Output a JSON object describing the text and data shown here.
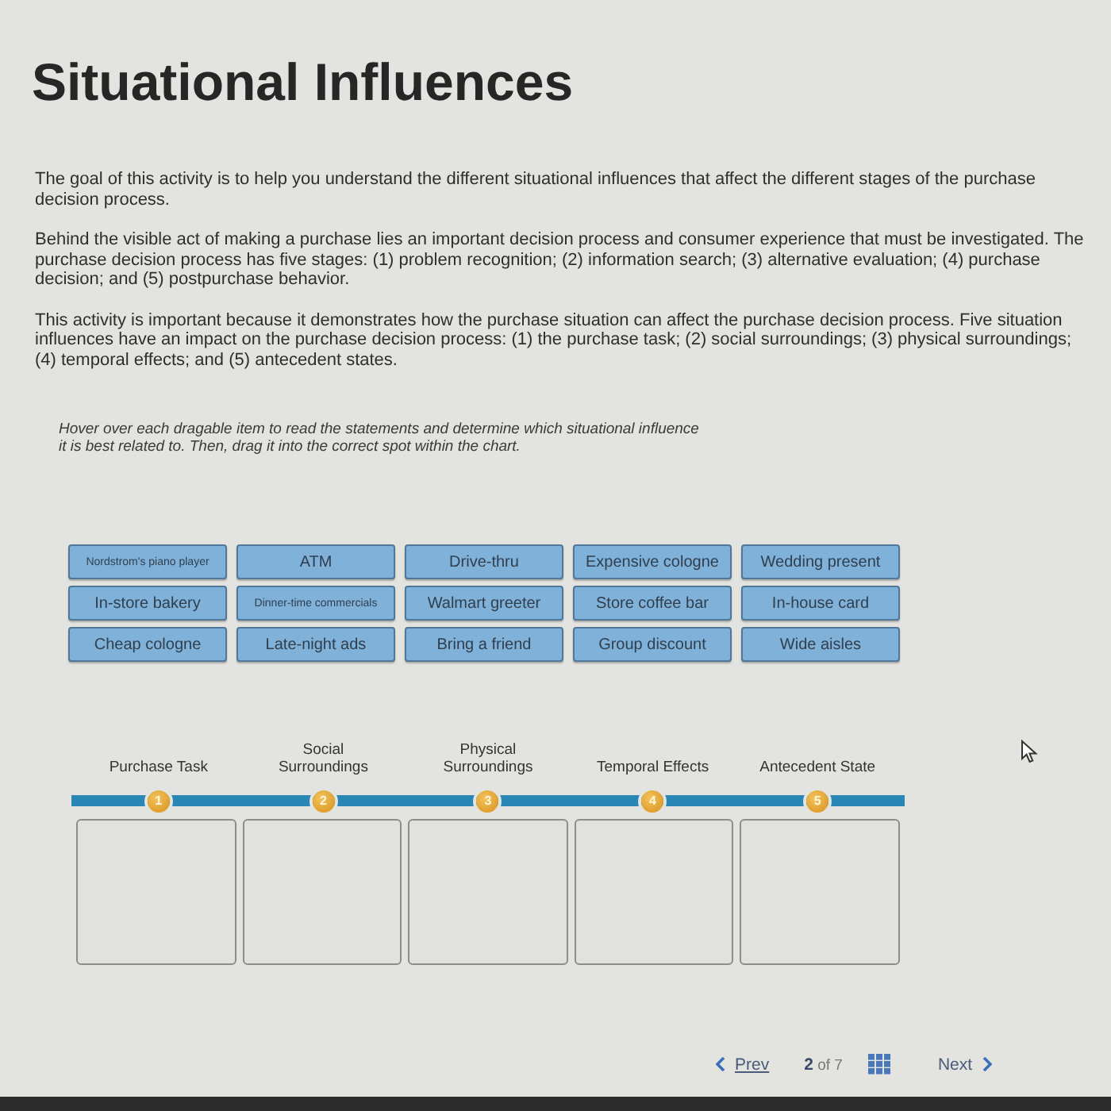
{
  "page": {
    "title": "Situational Influences"
  },
  "intro_paragraphs": [
    "The goal of this activity is to help you understand the different situational influences that affect the different stages of the purchase decision process.",
    "Behind the visible act of making a purchase lies an important decision process and consumer experience that must be investigated. The purchase decision process has five stages: (1) problem recognition; (2) information search; (3) alternative evaluation; (4) purchase decision; and (5) postpurchase behavior.",
    "This activity is important because it demonstrates how the purchase situation can affect the purchase decision process. Five situation influences have an impact on the purchase decision process: (1) the purchase task; (2) social surroundings; (3) physical surroundings; (4) temporal effects; and (5) antecedent states."
  ],
  "instructions": "Hover over each dragable item to read the statements and determine which situational influence it is best related to. Then, drag it into the correct spot within the chart.",
  "draggable_items": [
    {
      "label": "Nordstrom's piano player"
    },
    {
      "label": "ATM"
    },
    {
      "label": "Drive-thru"
    },
    {
      "label": "Expensive cologne"
    },
    {
      "label": "Wedding present"
    },
    {
      "label": "In-store bakery"
    },
    {
      "label": "Dinner-time commercials"
    },
    {
      "label": "Walmart greeter"
    },
    {
      "label": "Store coffee bar"
    },
    {
      "label": "In-house card"
    },
    {
      "label": "Cheap cologne"
    },
    {
      "label": "Late-night ads"
    },
    {
      "label": "Bring a friend"
    },
    {
      "label": "Group discount"
    },
    {
      "label": "Wide aisles"
    }
  ],
  "stages": [
    {
      "number": "1",
      "label": "Purchase Task"
    },
    {
      "number": "2",
      "label": "Social\nSurroundings"
    },
    {
      "number": "3",
      "label": "Physical\nSurroundings"
    },
    {
      "number": "4",
      "label": "Temporal Effects"
    },
    {
      "number": "5",
      "label": "Antecedent State"
    }
  ],
  "navigation": {
    "previous": "Prev",
    "page_indicator": "**2** of 7",
    "next": "Next"
  }
}
